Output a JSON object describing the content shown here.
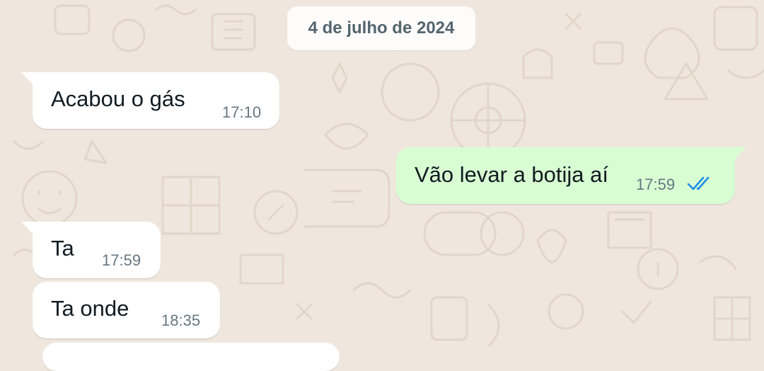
{
  "date_divider": "4 de julho de 2024",
  "messages": [
    {
      "direction": "incoming",
      "text": "Acabou o gás",
      "time": "17:10"
    },
    {
      "direction": "outgoing",
      "text": "Vão levar a botija aí",
      "time": "17:59",
      "status": "read",
      "status_icon": "double-check-icon",
      "status_color": "#1d8ee6"
    },
    {
      "direction": "incoming",
      "text": "Ta",
      "time": "17:59"
    },
    {
      "direction": "incoming",
      "text": "Ta onde",
      "time": "18:35"
    }
  ],
  "colors": {
    "wallpaper": "#efe7de",
    "incoming_bubble": "#ffffff",
    "outgoing_bubble": "#d9fdd3",
    "timestamp": "#667781",
    "text": "#111b21"
  }
}
